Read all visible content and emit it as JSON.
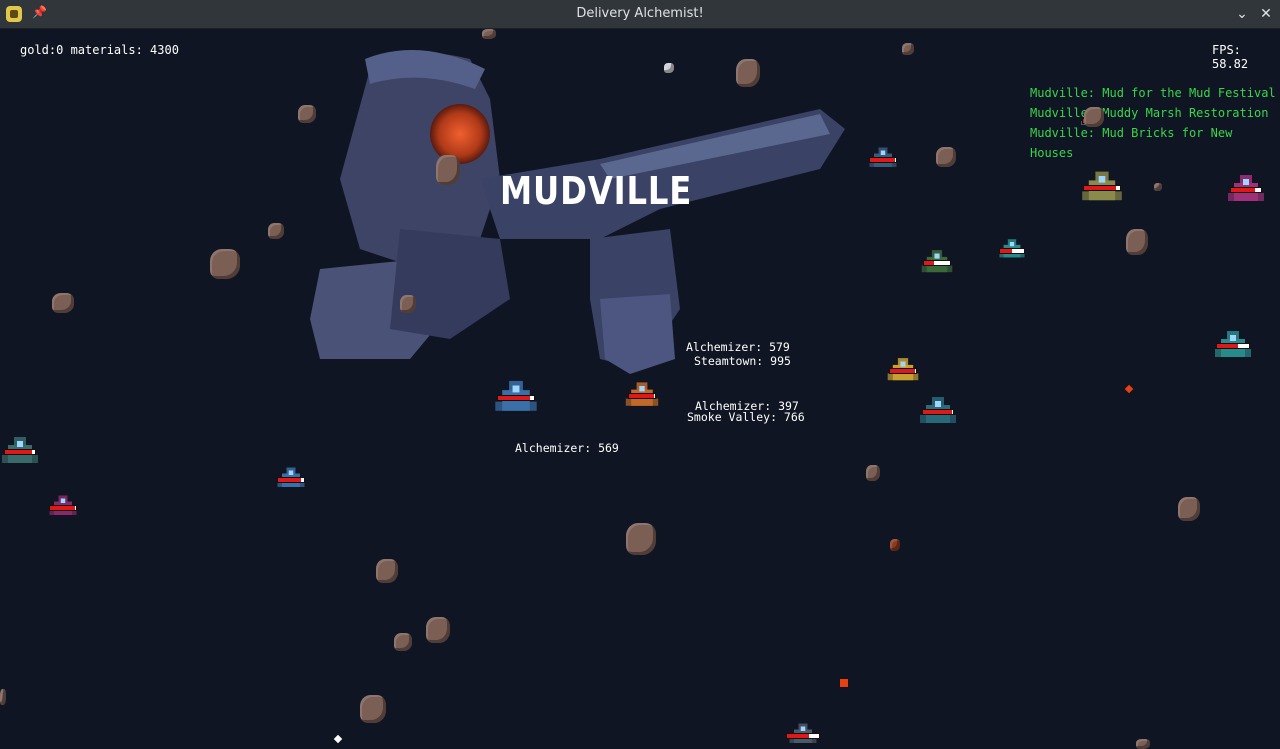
{
  "window": {
    "title": "Delivery Alchemist!"
  },
  "hud": {
    "resources": "gold:0 materials: 4300",
    "fps": "FPS: 58.82"
  },
  "quests": [
    "Mudville: Mud for the Mud Festival",
    "Mudville: Muddy Marsh Restoration",
    "Mudville: Mud Bricks for New Houses"
  ],
  "location": {
    "name": "MUDVILLE"
  },
  "labels": {
    "alchemizer_579": "Alchemizer: 579",
    "steamtown": "Steamtown: 995",
    "alchemizer_397": "Alchemizer: 397",
    "smoke_valley": "Smoke Valley: 766",
    "alchemizer_569": "Alchemizer: 569"
  },
  "ships": [
    {
      "name": "player-ship",
      "health": 0.9,
      "color": "#3a6fa8"
    },
    {
      "name": "enemy-ship",
      "health": 0.95,
      "color": "#c26a2a"
    },
    {
      "name": "enemy-ship",
      "health": 0.95,
      "color": "#3a5a7a"
    },
    {
      "name": "enemy-ship",
      "health": 0.9,
      "color": "#3a6b6b"
    },
    {
      "name": "enemy-ship",
      "health": 0.95,
      "color": "#8a2a6a"
    },
    {
      "name": "enemy-ship",
      "health": 0.9,
      "color": "#3a6fa8"
    },
    {
      "name": "enemy-ship",
      "health": 0.9,
      "color": "#8a8a4a"
    },
    {
      "name": "enemy-ship",
      "health": 0.8,
      "color": "#a0307a"
    },
    {
      "name": "enemy-ship",
      "health": 0.4,
      "color": "#3a6a3a"
    },
    {
      "name": "enemy-ship",
      "health": 0.5,
      "color": "#2a8a8a"
    },
    {
      "name": "enemy-ship",
      "health": 0.65,
      "color": "#2a8a8a"
    },
    {
      "name": "enemy-ship",
      "health": 0.95,
      "color": "#c8a030"
    },
    {
      "name": "enemy-ship",
      "health": 0.95,
      "color": "#2a6a7a"
    },
    {
      "name": "enemy-ship",
      "health": 0.7,
      "color": "#4a5a6a"
    },
    {
      "name": "enemy-ship",
      "health": 0.8,
      "color": "#2a8a8a"
    }
  ]
}
